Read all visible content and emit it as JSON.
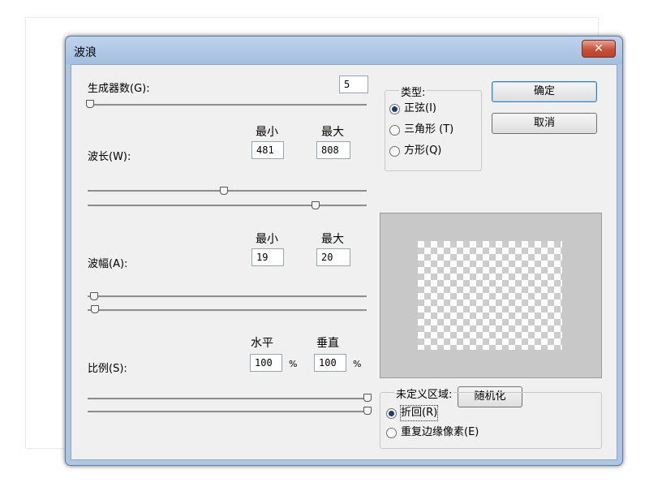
{
  "dialog": {
    "title": "波浪",
    "close_symbol": "✕"
  },
  "generators": {
    "label": "生成器数(G):",
    "value": "5"
  },
  "wavelength": {
    "label": "波长(W):",
    "min_label": "最小",
    "max_label": "最大",
    "min_value": "481",
    "max_value": "808"
  },
  "amplitude": {
    "label": "波幅(A):",
    "min_label": "最小",
    "max_label": "最大",
    "min_value": "19",
    "max_value": "20"
  },
  "scale": {
    "label": "比例(S):",
    "horizontal_label": "水平",
    "vertical_label": "垂直",
    "horizontal_value": "100",
    "vertical_value": "100",
    "unit": "%"
  },
  "type": {
    "legend": "类型:",
    "options": [
      "正弦(I)",
      "三角形 (T)",
      "方形(Q)"
    ],
    "selected": "正弦(I)"
  },
  "buttons": {
    "ok": "确定",
    "cancel": "取消",
    "randomize": "随机化"
  },
  "undefined_area": {
    "legend": "未定义区域:",
    "options": [
      "折回(R)",
      "重复边缘像素(E)"
    ],
    "selected": "折回(R)"
  },
  "colors": {
    "titlebar": "#aec6e2",
    "close_button": "#c6513a",
    "dialog_body": "#f0f0f0",
    "default_button_border": "#3c7fb1"
  }
}
